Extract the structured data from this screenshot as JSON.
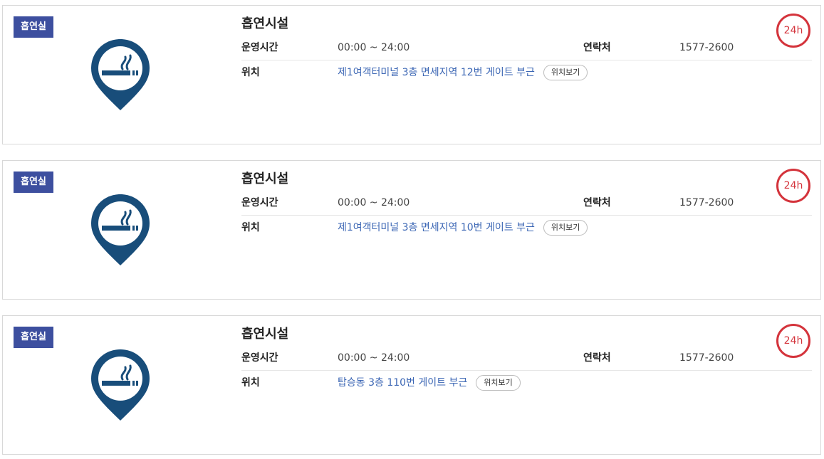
{
  "cards": [
    {
      "badge": "흡연실",
      "title": "흡연시설",
      "hours_label": "운영시간",
      "hours": "00:00 ~ 24:00",
      "contact_label": "연락처",
      "contact": "1577-2600",
      "location_label": "위치",
      "location": "제1여객터미널 3층 면세지역 12번 게이트 부근",
      "view_button": "위치보기",
      "open_badge": "24h",
      "icon": "smoking-area-pin-icon"
    },
    {
      "badge": "흡연실",
      "title": "흡연시설",
      "hours_label": "운영시간",
      "hours": "00:00 ~ 24:00",
      "contact_label": "연락처",
      "contact": "1577-2600",
      "location_label": "위치",
      "location": "제1여객터미널 3층 면세지역 10번 게이트 부근",
      "view_button": "위치보기",
      "open_badge": "24h",
      "icon": "smoking-area-pin-icon"
    },
    {
      "badge": "흡연실",
      "title": "흡연시설",
      "hours_label": "운영시간",
      "hours": "00:00 ~ 24:00",
      "contact_label": "연락처",
      "contact": "1577-2600",
      "location_label": "위치",
      "location": "탑승동 3층 110번 게이트 부근",
      "view_button": "위치보기",
      "open_badge": "24h",
      "icon": "smoking-area-pin-icon"
    }
  ],
  "colors": {
    "badge_bg": "#3d4f9f",
    "pin": "#184d7a",
    "link": "#3b66b4",
    "open_badge": "#d4343c"
  }
}
